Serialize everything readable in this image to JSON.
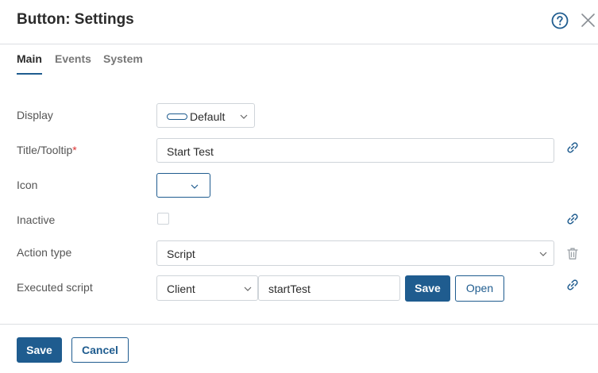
{
  "dialog": {
    "title": "Button: Settings",
    "help_icon": "help-circle-icon",
    "close_icon": "close-icon"
  },
  "tabs": [
    {
      "label": "Main",
      "active": true
    },
    {
      "label": "Events",
      "active": false
    },
    {
      "label": "System",
      "active": false
    }
  ],
  "form": {
    "display": {
      "label": "Display",
      "value": "Default"
    },
    "title_tooltip": {
      "label": "Title/Tooltip",
      "required_mark": "*",
      "value": "Start Test"
    },
    "icon": {
      "label": "Icon",
      "value": ""
    },
    "inactive": {
      "label": "Inactive",
      "checked": false
    },
    "action_type": {
      "label": "Action type",
      "value": "Script"
    },
    "executed_script": {
      "label": "Executed script",
      "mode_value": "Client",
      "script_value": "startTest",
      "save_label": "Save",
      "open_label": "Open"
    }
  },
  "footer": {
    "save_label": "Save",
    "cancel_label": "Cancel"
  },
  "colors": {
    "accent": "#1f5c8f",
    "required": "#dd3333",
    "border": "#cfd4d9"
  }
}
